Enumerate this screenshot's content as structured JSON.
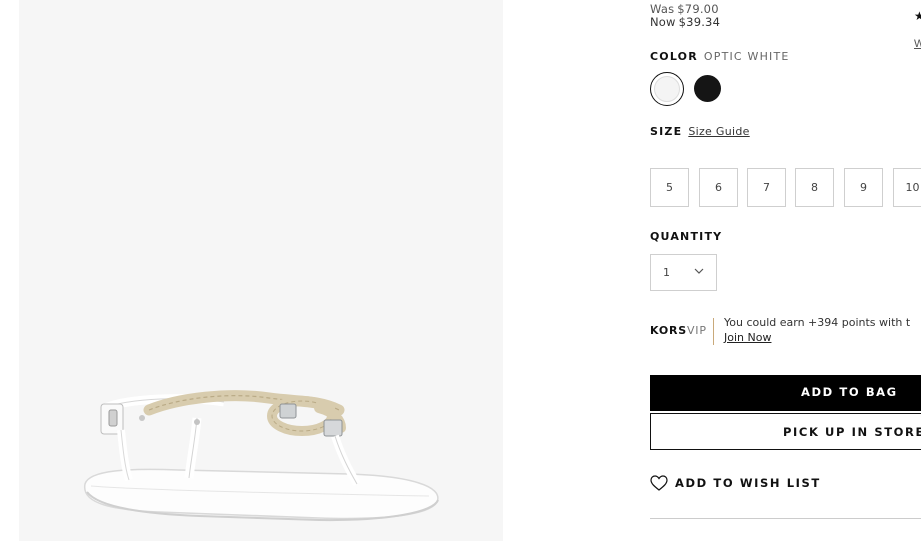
{
  "product_image": {
    "alt": "Rope thong sandal in optic white"
  },
  "pricing": {
    "was_label": "Was",
    "was_price": "$79.00",
    "now_label": "Now",
    "now_price": "$39.34"
  },
  "rating": {
    "star_icon": "star-icon",
    "link_text": "W"
  },
  "color": {
    "label": "COLOR",
    "selected_value": "OPTIC WHITE",
    "swatches": [
      {
        "name": "Optic White",
        "hex": "#f4f4f4",
        "selected": true
      },
      {
        "name": "Black",
        "hex": "#151515",
        "selected": false
      }
    ]
  },
  "size": {
    "label": "SIZE",
    "guide_link": "Size Guide",
    "options": [
      "5",
      "6",
      "7",
      "8",
      "9",
      "10"
    ]
  },
  "quantity": {
    "label": "QUANTITY",
    "selected": "1",
    "chevron_icon": "chevron-down-icon"
  },
  "vip": {
    "brand_bold": "KORS",
    "brand_light": "VIP",
    "message": "You could earn +394 points with t",
    "join_link": "Join Now",
    "divider_color": "#c9a97a"
  },
  "actions": {
    "add_to_bag": "ADD TO BAG",
    "pick_up_in_store": "PICK UP IN STORE",
    "add_to_wish_list": "ADD TO WISH LIST",
    "heart_icon": "heart-icon"
  },
  "colors": {
    "primary": "#000000",
    "panel_background": "#f6f6f6",
    "border": "#cfcfcf"
  }
}
